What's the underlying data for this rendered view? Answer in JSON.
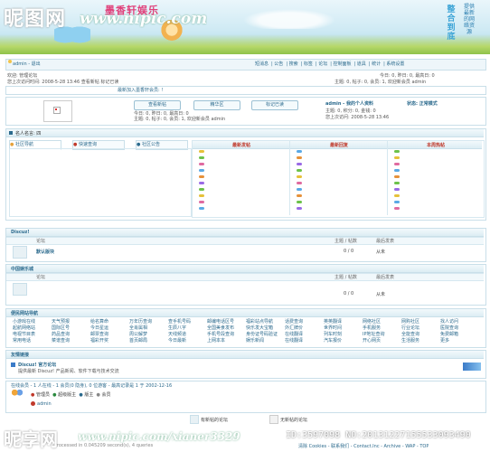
{
  "header": {
    "watermark_logo": "昵图网",
    "watermark_url": "www.nipic.com",
    "site_title": "墨香轩娱乐",
    "slogan_main": "整合到底",
    "slogan_sub": "提供最新的网络资源"
  },
  "nav": {
    "user": "admin - 退出",
    "links": [
      "短消息",
      "公告",
      "搜索",
      "标签",
      "论坛",
      "控制面板",
      "道具",
      "统计",
      "系统设置"
    ]
  },
  "info": {
    "line1": "欢迎: 管理论坛",
    "line2": "您上次访问时间: 2008-5-28 13:46 查看新帖  标记已读",
    "right1": "今日: 0, 昨日: 0, 最高日: 0",
    "right2": "主题: 0, 帖子: 0, 会员: 1, 欢迎新会员 admin"
  },
  "announcement": "最新加入墨香轩会员: !",
  "profile": {
    "buttons": [
      "查看新帖",
      "精华区",
      "标记已读"
    ],
    "stats1": "今日: 0, 昨日: 0, 最高日: 0",
    "stats2": "主题: 0, 帖子: 0, 会员: 1, 欢迎新会员 admin",
    "user_line": "admin - 我的个人资料",
    "status": "状态: 正常模式",
    "detail1": "主题: 0, 积分: 0, 金钱: 0",
    "detail2": "您上次访问: 2008-5-28 13:46"
  },
  "tabs_section": {
    "title": "名人名言: 四",
    "tabs": [
      "社区导航",
      "快速查询",
      "社区公告"
    ],
    "columns": [
      "最新发帖",
      "最新回复",
      "本周热帖"
    ],
    "row_colors": [
      "#e6c13a",
      "#6cc24a",
      "#e06aa0",
      "#5aa9e6",
      "#e6913a",
      "#9a6ae6",
      "#6cc24a",
      "#e6c13a",
      "#e06aa0",
      "#5aa9e6",
      "#e6913a",
      "#6cc24a",
      "#9a6ae6",
      "#e6c13a",
      "#5aa9e6",
      "#e06aa0"
    ]
  },
  "section1": {
    "name": "Discuz!",
    "header_forum": "论坛",
    "header_counts": "主题 / 帖数",
    "header_last": "最后发表",
    "forum_name": "默认版块",
    "counts": "0 / 0",
    "last": "从未"
  },
  "section2": {
    "name": "中国娱乐城",
    "header_forum": "论坛",
    "header_counts": "主题 / 帖数",
    "header_last": "最后发表",
    "counts": "0 / 0",
    "last": "从未"
  },
  "links_nav": {
    "title": "便民网站导航",
    "rows": [
      [
        "小游戏在线",
        "天气预报",
        "给名算命",
        "万年历查询",
        "查手机号码",
        "邮编电话区号",
        "福彩站点导航",
        "话费查询",
        "英英翻译",
        "网络社区",
        "网购社区",
        "找人访问"
      ],
      [
        "起航网络站",
        "国际区号",
        "今日星运",
        "全肖属相",
        "生辰八字",
        "全国美食发布",
        "快乐发大宝箱",
        "外汇牌价",
        "世界时间",
        "手机服务",
        "行业论坛",
        "医院查询"
      ],
      [
        "电视节目表",
        "药品查询",
        "邮票查询",
        "周公解梦",
        "天线频道",
        "手机号段查询",
        "身份证号码验证",
        "在线翻译",
        "列车时刻",
        "IP地址查询",
        "全能查询",
        "免费邮箱"
      ],
      [
        "常用电话",
        "菜谱查询",
        "福彩开奖",
        "首页邮局",
        "今日最新",
        "上网本本",
        "娱乐新闻",
        "在线翻译",
        "汽车报价",
        "开心网页",
        "生活服务",
        "更多"
      ]
    ]
  },
  "friends": {
    "title": "友情链接",
    "name": "Discuz! 官方论坛",
    "desc": "提供最新 Discuz! 产品新闻、软件下载与技术交流"
  },
  "online": {
    "title": "在线会员 - 1 人在线 - 1 会员(0 隐身), 0 位游客 - 最高记录是 1 于 2002-12-16",
    "legend": [
      "管理员",
      "超级版主",
      "版主",
      "会员"
    ],
    "user": "admin"
  },
  "footer": {
    "btn1": "有新帖的论坛",
    "btn2": "无新帖的论坛",
    "links": "清除 Cookies - 联系我们 - Contact.Inc - Archive - WAP - TOP",
    "copy": "Processed in 0.045209 second(s), 4 queries",
    "watermark": "昵享网",
    "watermark_url": "www.nipic.com/xianer3329",
    "watermark_id": "ID:3597098 NO:20131227155533093490"
  }
}
